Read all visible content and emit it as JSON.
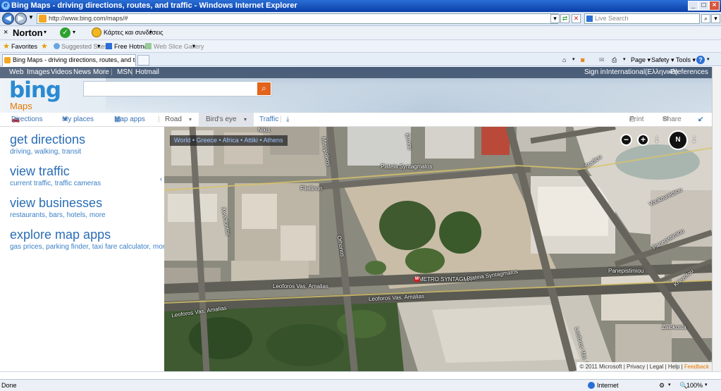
{
  "window": {
    "title": "Bing Maps - driving directions, routes, and traffic - Windows Internet Explorer",
    "address": "http://www.bing.com/maps/#",
    "search_placeholder": "Live Search"
  },
  "norton": {
    "brand": "Norton",
    "dropdown": "Κάρτες και συνδέσεις"
  },
  "favorites_bar": {
    "favorites": "Favorites",
    "suggested_sites": "Suggested Sites",
    "free_hotmail": "Free Hotmail",
    "web_slice_gallery": "Web Slice Gallery"
  },
  "tab": {
    "title": "Bing Maps - driving directions, routes, and traffic"
  },
  "command_bar": {
    "page": "Page",
    "safety": "Safety",
    "tools": "Tools"
  },
  "bing_nav": {
    "web": "Web",
    "images": "Images",
    "videos": "Videos",
    "news": "News",
    "more": "More",
    "msn": "MSN",
    "hotmail": "Hotmail",
    "sign_in": "Sign in",
    "region": "International(Ελληνικά)",
    "preferences": "Preferences"
  },
  "brand": {
    "logo": "bing",
    "section": "Maps"
  },
  "map_toolbar": {
    "directions": "Directions",
    "my_places": "My places",
    "map_apps": "Map apps",
    "road": "Road",
    "birds_eye": "Bird's eye",
    "traffic": "Traffic",
    "print": "Print",
    "share": "Share"
  },
  "left_panel": [
    {
      "title": "get directions",
      "subtitle": "driving, walking, transit"
    },
    {
      "title": "view traffic",
      "subtitle": "current traffic, traffic cameras"
    },
    {
      "title": "view businesses",
      "subtitle": "restaurants, bars, hotels, more"
    },
    {
      "title": "explore map apps",
      "subtitle": "gas prices, parking finder, taxi fare calculator, more"
    }
  ],
  "map": {
    "breadcrumb": "World • Greece • Africa • Attiki • Athens",
    "compass_label": "N",
    "streets": {
      "plateia_top": "Plateia Syntagmatos",
      "plateia_bottom": "Plateia Syntagmatos",
      "filellinon": "Filellinon",
      "othonos": "Othonos",
      "leoforos1": "Leoforos Vas. Amalias",
      "leoforos2": "Leoforos Vas. Amalias",
      "leoforos3": "Leoforos Vas. Amalias",
      "metro": "METRO SYNTAGMA",
      "metro_badge": "M",
      "voukourestiou": "Voukourestiou",
      "panepistimiou1": "Panepistimiou",
      "panepistimiou2": "Panepistimiou",
      "kriezotou": "Kriezotou",
      "zalokosta": "Zalokosta",
      "stadiou": "Stadiou",
      "ermou": "Ermou",
      "mitropoleos": "Mitropoleos",
      "xenofontos": "Xenofontos",
      "nikis": "Nikis",
      "lourdou": "Leoforos Vas. Sofias"
    },
    "copyright": {
      "text": "© 2011 Microsoft",
      "privacy": "Privacy",
      "legal": "Legal",
      "help": "Help",
      "feedback": "Feedback"
    }
  },
  "status_bar": {
    "status": "Done",
    "zone": "Internet",
    "zoom": "100%"
  },
  "colors": {
    "bing_blue": "#2a8ad2",
    "maps_orange": "#e87700",
    "link_blue": "#2a6db5",
    "search_button": "#e2631c"
  }
}
